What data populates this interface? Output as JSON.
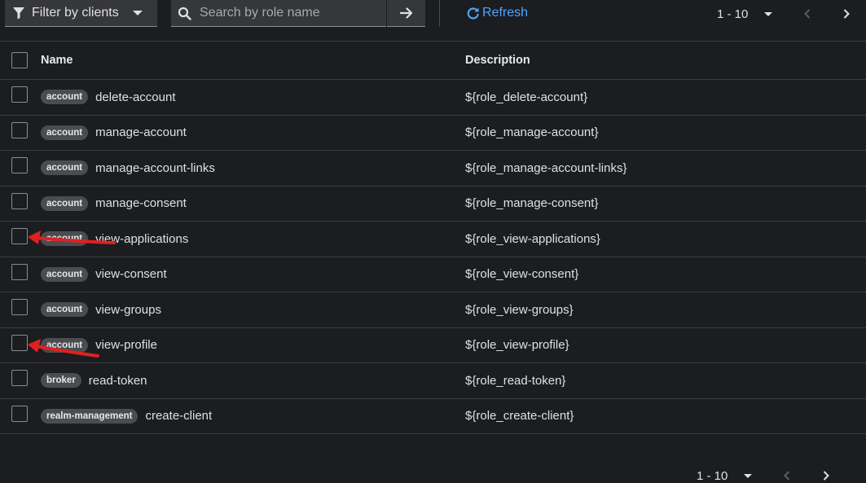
{
  "toolbar": {
    "filter_label": "Filter by clients",
    "search_placeholder": "Search by role name",
    "refresh_label": "Refresh",
    "pagination": "1 - 10"
  },
  "table": {
    "headers": {
      "name": "Name",
      "description": "Description"
    },
    "rows": [
      {
        "client": "account",
        "name": "delete-account",
        "description": "${role_delete-account}"
      },
      {
        "client": "account",
        "name": "manage-account",
        "description": "${role_manage-account}"
      },
      {
        "client": "account",
        "name": "manage-account-links",
        "description": "${role_manage-account-links}"
      },
      {
        "client": "account",
        "name": "manage-consent",
        "description": "${role_manage-consent}"
      },
      {
        "client": "account",
        "name": "view-applications",
        "description": "${role_view-applications}"
      },
      {
        "client": "account",
        "name": "view-consent",
        "description": "${role_view-consent}"
      },
      {
        "client": "account",
        "name": "view-groups",
        "description": "${role_view-groups}"
      },
      {
        "client": "account",
        "name": "view-profile",
        "description": "${role_view-profile}"
      },
      {
        "client": "broker",
        "name": "read-token",
        "description": "${role_read-token}"
      },
      {
        "client": "realm-management",
        "name": "create-client",
        "description": "${role_create-client}"
      }
    ]
  },
  "footer": {
    "pagination": "1 - 10"
  },
  "colors": {
    "accent": "#4ca6ff",
    "annotation_arrow": "#e02020"
  }
}
